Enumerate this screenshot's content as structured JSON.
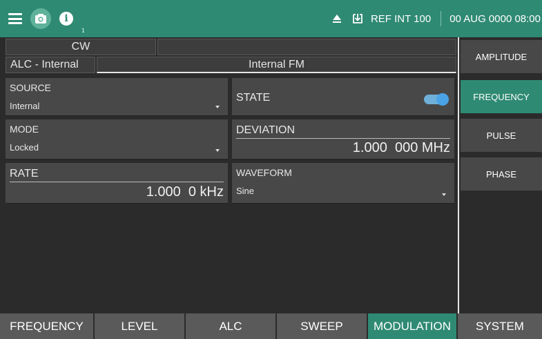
{
  "header": {
    "ref_label": "REF INT 100",
    "datetime": "00 AUG 0000 08:00",
    "info_badge": "1",
    "icons": [
      "menu-icon",
      "camera-icon",
      "info-icon",
      "eject-icon",
      "download-icon"
    ],
    "accent_color": "#2f8a73"
  },
  "status": {
    "mode": "CW",
    "alc": "ALC - Internal",
    "modulation": "Internal FM"
  },
  "params": {
    "source": {
      "label": "SOURCE",
      "value": "Internal"
    },
    "state": {
      "label": "STATE",
      "on": true
    },
    "mode": {
      "label": "MODE",
      "value": "Locked"
    },
    "deviation": {
      "label": "DEVIATION",
      "value": "1.000  000 MHz"
    },
    "rate": {
      "label": "RATE",
      "value": "1.000  0 kHz"
    },
    "waveform": {
      "label": "WAVEFORM",
      "value": "Sine"
    }
  },
  "sidebar": {
    "items": [
      {
        "label": "AMPLITUDE",
        "active": false
      },
      {
        "label": "FREQUENCY",
        "active": true
      },
      {
        "label": "PULSE",
        "active": false
      },
      {
        "label": "PHASE",
        "active": false
      }
    ]
  },
  "tabs": [
    {
      "label": "FREQUENCY",
      "active": false
    },
    {
      "label": "LEVEL",
      "active": false
    },
    {
      "label": "ALC",
      "active": false
    },
    {
      "label": "SWEEP",
      "active": false
    },
    {
      "label": "MODULATION",
      "active": true
    },
    {
      "label": "SYSTEM",
      "active": false
    }
  ]
}
